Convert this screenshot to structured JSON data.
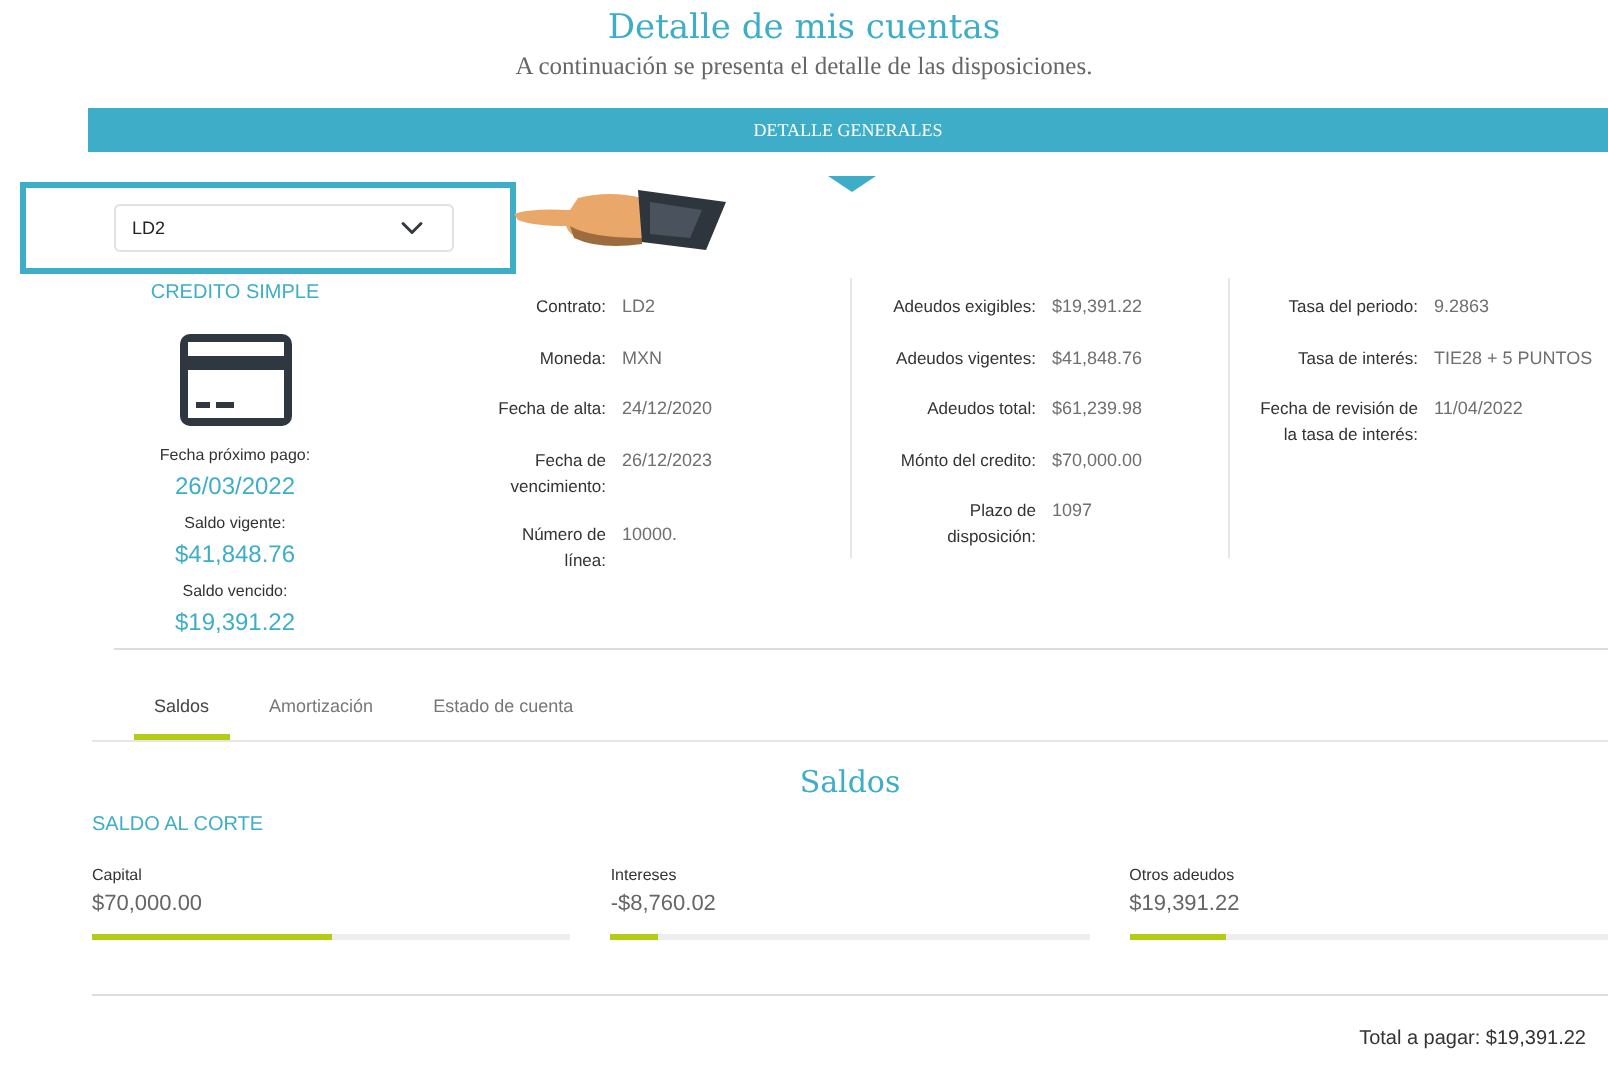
{
  "header": {
    "title": "Detalle de mis cuentas",
    "subtitle": "A continuación se presenta el detalle de las disposiciones."
  },
  "banner": {
    "label": "DETALLE GENERALES"
  },
  "account_select": {
    "value": "LD2"
  },
  "summary": {
    "product": "CREDITO SIMPLE",
    "items": [
      {
        "label": "Fecha próximo pago:",
        "value": "26/03/2022"
      },
      {
        "label": "Saldo vigente:",
        "value": "$41,848.76"
      },
      {
        "label": "Saldo vencido:",
        "value": "$19,391.22"
      }
    ]
  },
  "detail_columns": [
    [
      {
        "label": "Contrato:",
        "value": "LD2"
      },
      {
        "label": "Moneda:",
        "value": "MXN"
      },
      {
        "label": "Fecha de alta:",
        "value": "24/12/2020"
      },
      {
        "label": "Fecha de vencimiento:",
        "value": "26/12/2023"
      },
      {
        "label": "Número de línea:",
        "value": "10000."
      }
    ],
    [
      {
        "label": "Adeudos exigibles:",
        "value": "$19,391.22"
      },
      {
        "label": "Adeudos vigentes:",
        "value": "$41,848.76"
      },
      {
        "label": "Adeudos total:",
        "value": "$61,239.98"
      },
      {
        "label": "Mónto del credito:",
        "value": "$70,000.00"
      },
      {
        "label": "Plazo de disposición:",
        "value": "1097"
      }
    ],
    [
      {
        "label": "Tasa del periodo:",
        "value": "9.2863"
      },
      {
        "label": "Tasa de interés:",
        "value": "TIE28 + 5 PUNTOS"
      },
      {
        "label": "Fecha de revisión de la tasa de interés:",
        "value": "11/04/2022"
      }
    ]
  ],
  "tabs": [
    {
      "label": "Saldos",
      "selected": true
    },
    {
      "label": "Amortización",
      "selected": false
    },
    {
      "label": "Estado de cuenta",
      "selected": false
    }
  ],
  "section": {
    "title": "Saldos",
    "subtitle": "SALDO AL CORTE"
  },
  "balances": [
    {
      "label": "Capital",
      "value": "$70,000.00",
      "level": 0.5
    },
    {
      "label": "Intereses",
      "value": "-$8,760.02",
      "level": 0.1
    },
    {
      "label": "Otros adeudos",
      "value": "$19,391.22",
      "level": 0.2
    }
  ],
  "total": {
    "text": "Total a pagar: $19,391.22"
  }
}
